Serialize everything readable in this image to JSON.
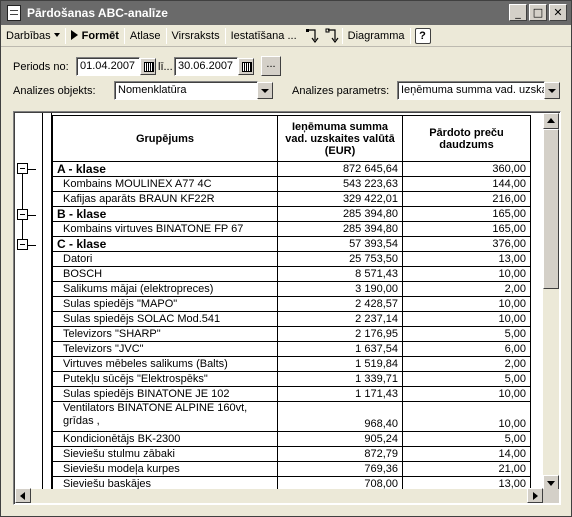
{
  "window": {
    "title": "Pārdošanas ABC-analīze",
    "buttons": {
      "minimize": "_",
      "maximize": "□",
      "close": "✕"
    }
  },
  "toolbar": {
    "darbibas": "Darbības",
    "format": "Formēt",
    "atlase": "Atlase",
    "virsraksts": "Virsraksts",
    "iestatisana": "Iestatīšana ...",
    "diagramma": "Diagramma",
    "help": "?"
  },
  "filters": {
    "period_label": "Periods no:",
    "date_from": "01.04.2007",
    "till_label": "lī...",
    "date_to": "30.06.2007",
    "ellipsis": "...",
    "object_label": "Analizes objekts:",
    "object_value": "Nomenklatūra",
    "param_label": "Analizes parametrs:",
    "param_value": "Ieņēmuma summa vad. uzskai"
  },
  "table": {
    "headers": {
      "group": "Grupējums",
      "revenue": "Ieņēmuma summa vad. uzskaites valūtā (EUR)",
      "qty": "Pārdoto preču daudzums"
    },
    "rows": [
      {
        "name": "A - klase",
        "revenue": "872 645,64",
        "qty": "360,00",
        "klase": true
      },
      {
        "name": "Kombains MOULINEX  A77 4C",
        "revenue": "543 223,63",
        "qty": "144,00"
      },
      {
        "name": "Kafijas aparāts BRAUN KF22R",
        "revenue": "329 422,01",
        "qty": "216,00"
      },
      {
        "name": "B - klase",
        "revenue": "285 394,80",
        "qty": "165,00",
        "klase": true
      },
      {
        "name": "Kombains virtuves BINATONE FP 67",
        "revenue": "285 394,80",
        "qty": "165,00"
      },
      {
        "name": "C - klase",
        "revenue": "57 393,54",
        "qty": "376,00",
        "klase": true
      },
      {
        "name": "Datori",
        "revenue": "25 753,50",
        "qty": "13,00"
      },
      {
        "name": "BOSCH",
        "revenue": "8 571,43",
        "qty": "10,00"
      },
      {
        "name": "Salikums mājai (elektropreces)",
        "revenue": "3 190,00",
        "qty": "2,00"
      },
      {
        "name": "Sulas spiedējs \"MAPO\"",
        "revenue": "2 428,57",
        "qty": "10,00"
      },
      {
        "name": "Sulas spiedējs  SOLAC  Mod.541",
        "revenue": "2 237,14",
        "qty": "10,00"
      },
      {
        "name": "Televizors \"SHARP\"",
        "revenue": "2 176,95",
        "qty": "5,00"
      },
      {
        "name": "Televizors \"JVC\"",
        "revenue": "1 637,54",
        "qty": "6,00"
      },
      {
        "name": "Virtuves mēbeles salikums (Balts)",
        "revenue": "1 519,84",
        "qty": "2,00"
      },
      {
        "name": "Putekļu sūcējs \"Elektrospēks\"",
        "revenue": "1 339,71",
        "qty": "5,00"
      },
      {
        "name": "Sulas spiedējs  BINATONE JE 102",
        "revenue": "1 171,43",
        "qty": "10,00"
      },
      {
        "name": "Ventilators BINATONE ALPINE 160vt, grīdas ,",
        "revenue": "968,40",
        "qty": "10,00",
        "tall": true
      },
      {
        "name": "Kondicionētājs BK-2300",
        "revenue": "905,24",
        "qty": "5,00"
      },
      {
        "name": "Sieviešu stulmu zābaki",
        "revenue": "872,79",
        "qty": "14,00"
      },
      {
        "name": "Sieviešu modeļa kurpes",
        "revenue": "769,36",
        "qty": "21,00"
      },
      {
        "name": "Sieviešu baskājes",
        "revenue": "708,00",
        "qty": "13,00"
      }
    ]
  },
  "colors": {
    "titlebar": "#6a6a6a",
    "window_bg": "#ece9d8",
    "grid_bg": "#ffffff"
  }
}
